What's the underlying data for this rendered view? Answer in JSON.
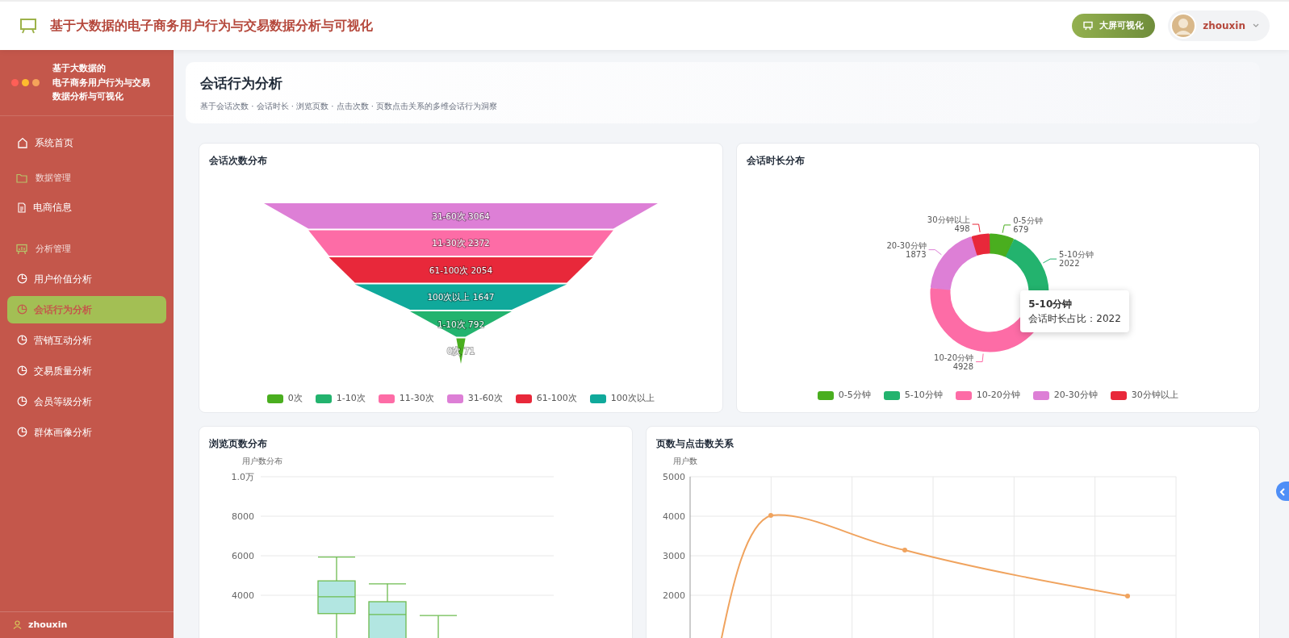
{
  "header": {
    "title": "基于大数据的电子商务用户行为与交易数据分析与可视化",
    "screen_button": "大屏可视化",
    "user": "zhouxin"
  },
  "sidebar": {
    "brand_lines": [
      "基于大数据的",
      "电子商务用户行为与交易",
      "数据分析与可视化"
    ],
    "home": {
      "label": "系统首页",
      "selected": false
    },
    "groups": [
      {
        "label": "数据管理",
        "children": [
          {
            "label": "电商信息",
            "selected": false
          }
        ]
      },
      {
        "label": "分析管理",
        "children": [
          {
            "label": "用户价值分析",
            "selected": false
          },
          {
            "label": "会话行为分析",
            "selected": true
          },
          {
            "label": "营销互动分析",
            "selected": false
          },
          {
            "label": "交易质量分析",
            "selected": false
          },
          {
            "label": "会员等级分析",
            "selected": false
          },
          {
            "label": "群体画像分析",
            "selected": false
          }
        ]
      }
    ],
    "user": "zhouxin"
  },
  "page": {
    "title": "会话行为分析",
    "subtitle": "基于会话次数 · 会话时长 · 浏览页数 · 点击次数 · 页数点击关系的多维会话行为洞察"
  },
  "cards": [
    {
      "kind": "funnel",
      "title": "会话次数分布",
      "segments": [
        {
          "label": "31-60次 3064",
          "color": "#dd7fd6"
        },
        {
          "label": "11-30次 2372",
          "color": "#fd6ca6"
        },
        {
          "label": "61-100次 2054",
          "color": "#e8283a"
        },
        {
          "label": "100次以上 1647",
          "color": "#10a99b"
        },
        {
          "label": "1-10次 792",
          "color": "#23b36e"
        },
        {
          "label": "0次 71",
          "color": "#4aae1f"
        }
      ],
      "legend": [
        {
          "label": "0次",
          "color": "#4aae1f"
        },
        {
          "label": "1-10次",
          "color": "#23b36e"
        },
        {
          "label": "11-30次",
          "color": "#fd6ca6"
        },
        {
          "label": "31-60次",
          "color": "#dd7fd6"
        },
        {
          "label": "61-100次",
          "color": "#e8283a"
        },
        {
          "label": "100次以上",
          "color": "#10a99b"
        }
      ]
    },
    {
      "kind": "donut",
      "title": "会话时长分布",
      "chart_data": {
        "type": "donut",
        "categories": [
          "0-5分钟",
          "5-10分钟",
          "10-20分钟",
          "20-30分钟",
          "30分钟以上"
        ],
        "values": [
          679,
          2022,
          4928,
          1873,
          498
        ],
        "colors": [
          "#4aae1f",
          "#23b36e",
          "#fd6ca6",
          "#dd7fd6",
          "#e8283a"
        ],
        "data_labels": true
      },
      "tooltip": {
        "title": "5-10分钟",
        "text": "会话时长占比：2022"
      }
    },
    {
      "kind": "boxplot",
      "title": "浏览页数分布",
      "y_axis": {
        "title": "用户数分布",
        "ticks": [
          "1.0万",
          "8000",
          "6000",
          "4000"
        ]
      }
    },
    {
      "kind": "line",
      "title": "页数与点击数关系",
      "y_axis": {
        "title": "用户数",
        "ticks": [
          "5000",
          "4000",
          "3000",
          "2000"
        ]
      }
    }
  ]
}
